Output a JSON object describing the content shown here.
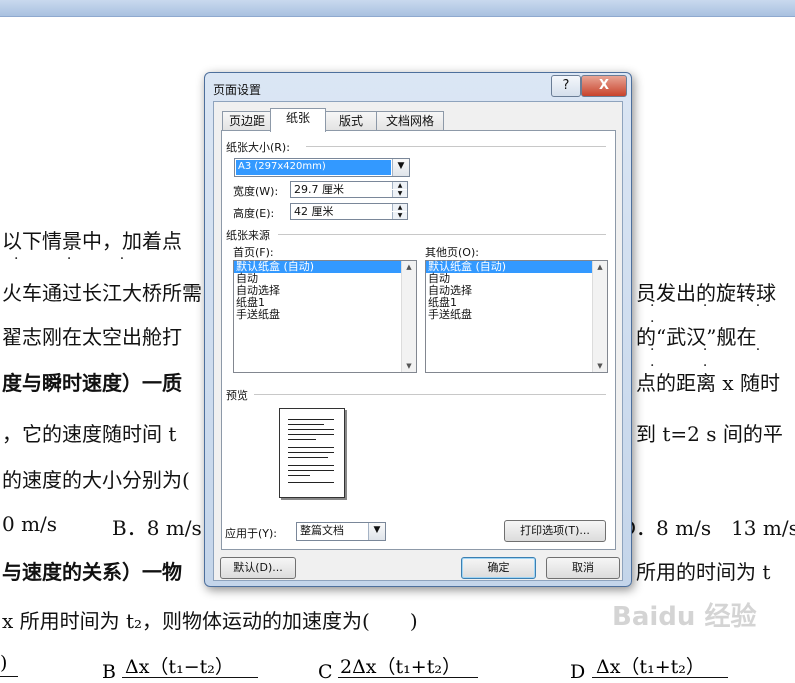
{
  "document": {
    "lines": [
      "以下情景中，加着点",
      "火车通过长江大桥所需",
      "员发出的旋转球",
      "翟志刚在太空出舱打",
      "的“武汉”舰在",
      "度与瞬时速度）一质",
      "点的距离 x 随时",
      "，它的速度随时间 t",
      "到 t=2 s 间的平",
      "的速度的大小分别为(",
      "0 m/s",
      "B．8 m/s",
      "D．8 m/s　13 m/s",
      "与速度的关系）一物",
      "所用的时间为 t",
      "x 所用时间为 t₂，则物体运动的加速度为(　　)",
      "Δx（t₁−t₂）",
      "2Δx（t₁+t₂）",
      "Δx（t₁+t₂）"
    ],
    "option_b": "B",
    "option_c": "C",
    "option_d": "D",
    "watermark": "Baidu 经验"
  },
  "dialog": {
    "title": "页面设置",
    "help_label": "?",
    "close_label": "X",
    "tabs": [
      "页边距",
      "纸张",
      "版式",
      "文档网格"
    ],
    "active_tab": "纸张",
    "paper_size": {
      "group": "纸张大小(R):",
      "value": "A3 (297x420mm)",
      "width_label": "宽度(W):",
      "width_value": "29.7 厘米",
      "height_label": "高度(E):",
      "height_value": "42 厘米"
    },
    "paper_source": {
      "group": "纸张来源",
      "first_page_label": "首页(F):",
      "other_pages_label": "其他页(O):",
      "first_page_items": [
        "默认纸盒 (自动)",
        "自动",
        "自动选择",
        "纸盘1",
        "手送纸盘"
      ],
      "other_pages_items": [
        "默认纸盒 (自动)",
        "自动",
        "自动选择",
        "纸盘1",
        "手送纸盘"
      ],
      "selected_index": 0
    },
    "preview": {
      "group": "预览"
    },
    "apply_to": {
      "label": "应用于(Y):",
      "value": "整篇文档"
    },
    "print_options_label": "打印选项(T)...",
    "default_label": "默认(D)...",
    "ok_label": "确定",
    "cancel_label": "取消"
  }
}
